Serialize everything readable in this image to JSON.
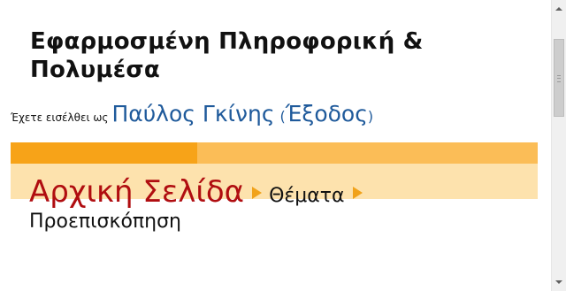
{
  "header": {
    "site_title": "Εφαρμοσμένη Πληροφορική & Πολυμέσα",
    "login_prefix": "Έχετε εισέλθει ως",
    "user_name": "Παύλος Γκίνης",
    "paren_open": "(",
    "logout_label": "Έξοδος",
    "paren_close": ")"
  },
  "navbar": {
    "colors": {
      "top_left": "#f7a318",
      "top_right": "#fbbd57",
      "bottom": "#fde2ad"
    }
  },
  "breadcrumb": {
    "home_label": "Αρχική Σελίδα",
    "topics_label": "Θέματα",
    "current_label": "Προεπισκόπηση",
    "separator_icon": "triangle-right-icon",
    "separator_color": "#f1a21a"
  },
  "colors": {
    "link": "#1f5a9b",
    "home_link": "#b00d10",
    "text": "#111111"
  },
  "scrollbar": {
    "up_icon": "scroll-up-arrow-icon",
    "down_icon": "scroll-down-arrow-icon"
  }
}
